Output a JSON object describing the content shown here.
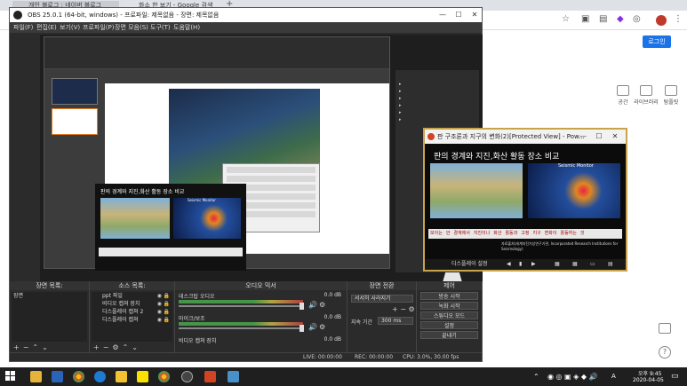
{
  "browser": {
    "tabs": [
      {
        "title": "개인 블로그 : 네이버 블로그"
      },
      {
        "title": "화소 한 보기 - Google 검색"
      }
    ],
    "login_label": "로그인",
    "shortcuts": [
      "공간",
      "라이브러리",
      "탐플릿"
    ],
    "new_tab": "+"
  },
  "obs": {
    "title": "OBS 25.0.1 (64-bit, windows) - 프로파일: 제목없음 - 장면: 제목없음",
    "menu": [
      "파일(F)",
      "편집(E)",
      "보기(V)",
      "프로파일(P)",
      "장면 모음(S)",
      "도구(T)",
      "도움말(H)"
    ],
    "panels": {
      "scenes": {
        "header": "장면 목록:",
        "items": [
          "장면"
        ]
      },
      "sources": {
        "header": "소스 목록:",
        "items": [
          "ppt 파일",
          "비디오 캡쳐 장치",
          "디스플레이 캡쳐 2",
          "디스플레이 캡쳐"
        ]
      },
      "mixer": {
        "header": "오디오 믹서",
        "channels": [
          {
            "name": "데스크탑 오디오",
            "db": "0.0 dB"
          },
          {
            "name": "마이크/보조",
            "db": "0.0 dB"
          },
          {
            "name": "비디오 캡쳐 장치",
            "db": "0.0 dB"
          }
        ]
      },
      "transitions": {
        "header": "장면 전환",
        "type": "서서히 사라지기",
        "duration_label": "지속 기간",
        "duration": "300 ms"
      },
      "controls": {
        "header": "제어",
        "buttons": [
          "방송 시작",
          "녹화 시작",
          "스튜디오 모드",
          "설정",
          "끝내기"
        ]
      }
    },
    "status": {
      "live": "LIVE: 00:00:00",
      "rec": "REC: 00:00:00",
      "cpu": "CPU: 3.0%, 30.00 fps"
    },
    "capture": {
      "slide_title": "판 구조론과 지구의 변화(2)",
      "slide_words": [
        "판의",
        "경계와",
        "지진,화산",
        "활동",
        "장소",
        "비교"
      ],
      "monitor_label": "Seismic Monitor"
    }
  },
  "ppt": {
    "title": "판 구조론과 지구의 변화(2)[Protected View] - Pow...",
    "slide_words": [
      "판의",
      "경계와",
      "지진,화산",
      "활동",
      "장소",
      "비교"
    ],
    "monitor_label": "Seismic Monitor",
    "legend_row": [
      "보이는",
      "안",
      "경계에서",
      "지진이나",
      "화산",
      "활동과",
      "고정",
      "지구",
      "변화이",
      "활동하는",
      "것"
    ],
    "source_note": "자료출처(세계지진기상연구기관, Incorporated Research Institutions for Seismology)",
    "display_settings": "디스플레이 설정"
  },
  "taskbar": {
    "clock_time": "오후 9:45",
    "clock_date": "2020-04-05",
    "lang": "A"
  },
  "colors": {
    "obs_bg": "#2b2b2b",
    "ppt_border": "#c7a44a",
    "accent": "#1a73e8"
  }
}
